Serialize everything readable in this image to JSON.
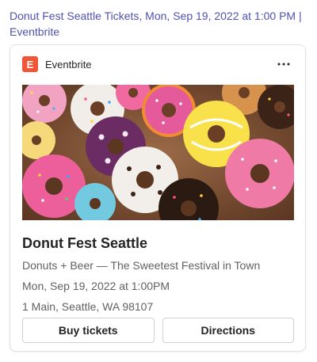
{
  "link": {
    "title": "Donut Fest Seattle Tickets, Mon, Sep 19, 2022 at 1:00 PM | Eventbrite"
  },
  "card": {
    "provider": {
      "icon_letter": "E",
      "icon_color": "#f05537",
      "name": "Eventbrite"
    },
    "more_icon": "more-horizontal-icon",
    "image": {
      "subject": "photo-of-colorful-sprinkled-donuts"
    },
    "title": "Donut Fest Seattle",
    "subtitle": "Donuts + Beer — The Sweetest Festival in Town",
    "datetime": "Mon, Sep 19, 2022 at 1:00PM",
    "address": "1 Main, Seattle, WA 98107",
    "actions": [
      {
        "label": "Buy tickets"
      },
      {
        "label": "Directions"
      }
    ]
  },
  "colors": {
    "link": "#4f52b2",
    "card_border": "#e1e1e1"
  }
}
